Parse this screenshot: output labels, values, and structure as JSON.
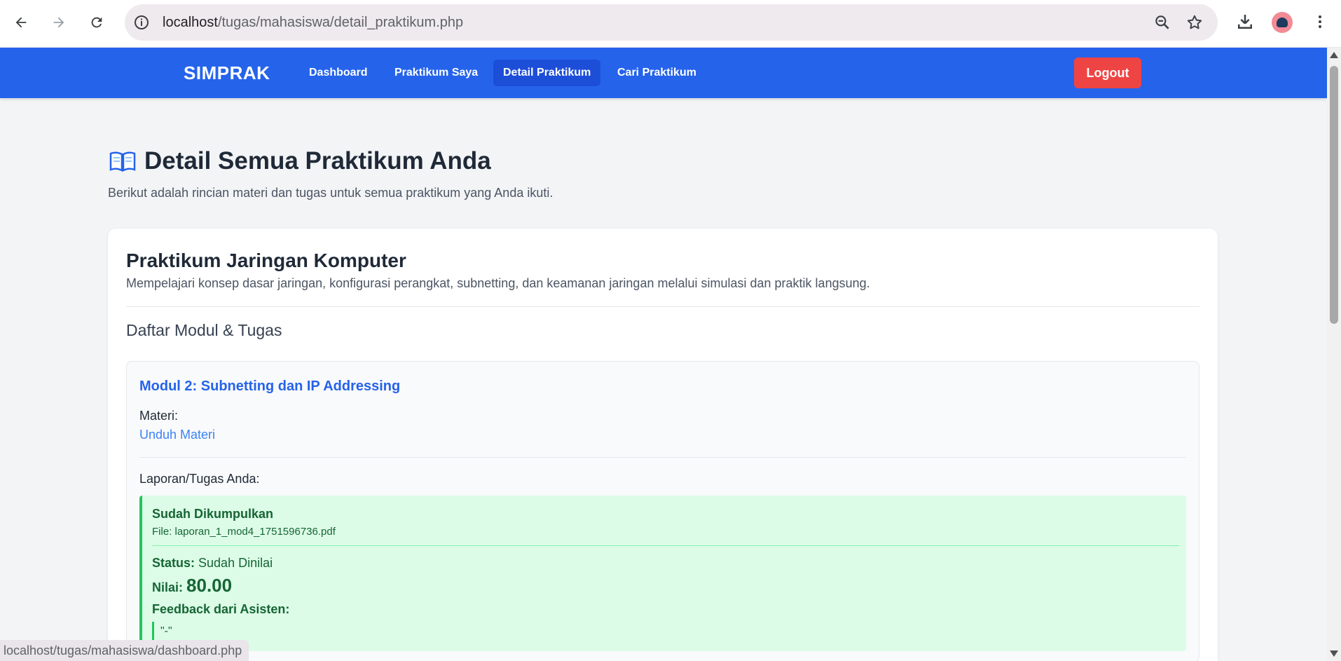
{
  "browser": {
    "url_host": "localhost",
    "url_path": "/tugas/mahasiswa/detail_praktikum.php",
    "status_url": "localhost/tugas/mahasiswa/dashboard.php"
  },
  "navbar": {
    "brand": "SIMPRAK",
    "items": [
      {
        "label": "Dashboard",
        "active": false
      },
      {
        "label": "Praktikum Saya",
        "active": false
      },
      {
        "label": "Detail Praktikum",
        "active": true
      },
      {
        "label": "Cari Praktikum",
        "active": false
      }
    ],
    "logout_label": "Logout"
  },
  "page": {
    "title": "Detail Semua Praktikum Anda",
    "title_icon": "open-book-icon",
    "subtitle": "Berikut adalah rincian materi dan tugas untuk semua praktikum yang Anda ikuti."
  },
  "praktikum": {
    "title": "Praktikum Jaringan Komputer",
    "description": "Mempelajari konsep dasar jaringan, konfigurasi perangkat, subnetting, dan keamanan jaringan melalui simulasi dan praktik langsung.",
    "section_title": "Daftar Modul & Tugas",
    "module": {
      "title": "Modul 2: Subnetting dan IP Addressing",
      "materi_label": "Materi:",
      "materi_link": "Unduh Materi",
      "laporan_label": "Laporan/Tugas Anda:",
      "submission": {
        "status_heading": "Sudah Dikumpulkan",
        "file_text": "File: laporan_1_mod4_1751596736.pdf",
        "status_label": "Status:",
        "status_value": "Sudah Dinilai",
        "nilai_label": "Nilai:",
        "nilai_value": "80.00",
        "feedback_label": "Feedback dari Asisten:",
        "feedback_text": "\"-\""
      }
    }
  },
  "colors": {
    "primary": "#2563eb",
    "primary_active": "#1d4ed8",
    "logout": "#ef4444",
    "success_bg": "#dcfce7",
    "success_text": "#166534",
    "success_border": "#22c55e"
  }
}
